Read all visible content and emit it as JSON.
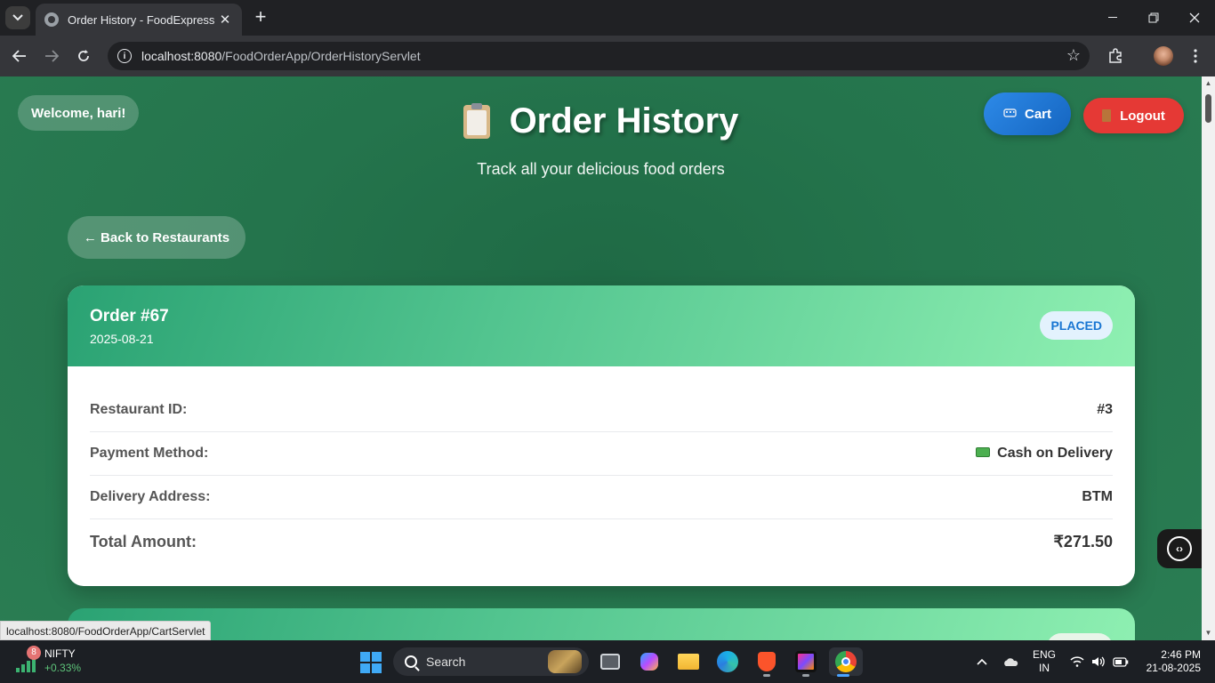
{
  "browser": {
    "tab_title": "Order History - FoodExpress",
    "url_host": "localhost:8080",
    "url_path": "/FoodOrderApp/OrderHistoryServlet",
    "status_url": "localhost:8080/FoodOrderApp/CartServlet",
    "icons": [
      "tab-search-icon",
      "favicon-icon",
      "close-icon",
      "new-tab-icon",
      "minimize-icon",
      "maximize-icon",
      "window-close-icon",
      "back-icon",
      "forward-icon",
      "reload-icon",
      "site-info-icon",
      "bookmark-star-icon",
      "extensions-icon",
      "profile-avatar",
      "menu-icon"
    ]
  },
  "header": {
    "welcome": "Welcome, hari!",
    "title": "Order History",
    "subtitle": "Track all your delicious food orders",
    "cart_label": "Cart",
    "logout_label": "Logout",
    "back_label": "← Back to Restaurants"
  },
  "orders": [
    {
      "title": "Order #67",
      "date": "2025-08-21",
      "status": "PLACED",
      "details": [
        {
          "label": "Restaurant ID:",
          "value": "#3"
        },
        {
          "label": "Payment Method:",
          "value": "Cash on Delivery"
        },
        {
          "label": "Delivery Address:",
          "value": "BTM"
        }
      ],
      "total_label": "Total Amount:",
      "total_value": "₹271.50"
    }
  ],
  "taskbar": {
    "nifty_badge": "8",
    "nifty_name": "NIFTY",
    "nifty_change": "+0.33%",
    "search_label": "Search",
    "lang_line1": "ENG",
    "lang_line2": "IN",
    "time": "2:46 PM",
    "date": "21-08-2025"
  },
  "colors": {
    "page_green": "#24744c",
    "header_gradient_start": "#2aa273",
    "header_gradient_end": "#8ff0b2",
    "cart_blue": "#1e78d6",
    "logout_red": "#e53935",
    "status_text": "#1976d2"
  }
}
